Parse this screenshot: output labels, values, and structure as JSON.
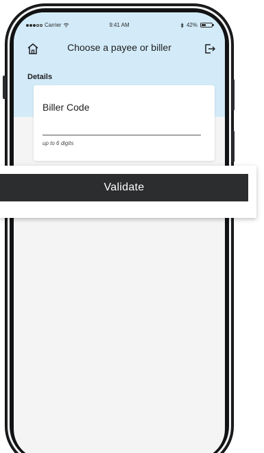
{
  "status_bar": {
    "carrier": "Carrier",
    "time": "9:41 AM",
    "battery": "42%",
    "battery_level": 0.42
  },
  "nav": {
    "title": "Choose a payee or biller",
    "home_icon": "home-icon",
    "logout_icon": "logout-icon"
  },
  "section": {
    "label": "Details"
  },
  "form": {
    "biller_code_label": "Biller Code",
    "biller_code_value": "",
    "biller_code_hint": "up to 6 digits"
  },
  "actions": {
    "validate_label": "Validate"
  },
  "colors": {
    "header_bg": "#d3ebf8",
    "button_bg": "#2c2d2f",
    "screen_bg": "#f4f4f4"
  }
}
